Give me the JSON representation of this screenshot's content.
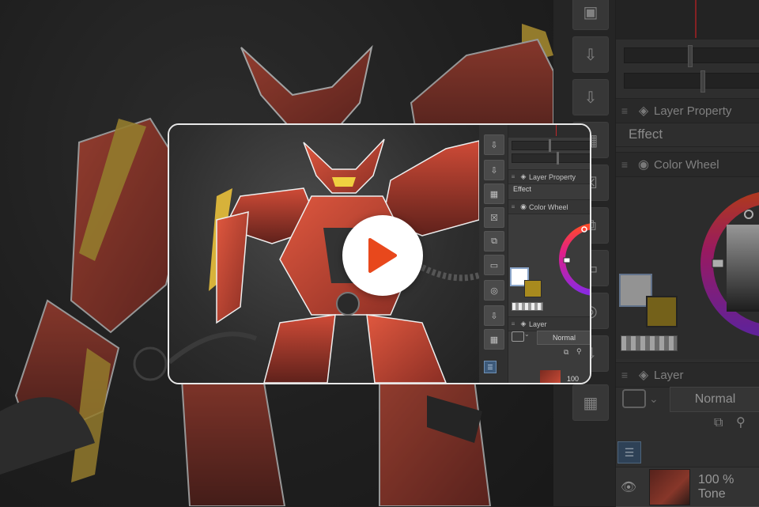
{
  "background_panel": {
    "layer_property_label": "Layer Property",
    "effect_label": "Effect",
    "color_wheel_label": "Color Wheel",
    "layer_label": "Layer",
    "blend_mode": "Normal",
    "opacity_text": "100 %",
    "tone_text": "Tone",
    "thumb_pct_small": "100"
  },
  "video_card": {
    "layer_property_label": "Layer Property",
    "effect_label": "Effect",
    "color_wheel_label": "Color Wheel",
    "layer_label": "Layer",
    "blend_mode": "Normal",
    "opacity_text": "100"
  },
  "colors": {
    "play_icon": "#e8481c",
    "main_color": "#d8d8d8",
    "sub_color": "#a88a1e",
    "accent_red": "#c0282b"
  },
  "icons": {
    "play": "play-icon",
    "tools": [
      "layer-3d-icon",
      "export-icon",
      "export-icon",
      "grid-icon",
      "x-box-icon",
      "clip-icon",
      "folder-icon",
      "camera-icon",
      "import-icon",
      "grid-icon"
    ]
  }
}
